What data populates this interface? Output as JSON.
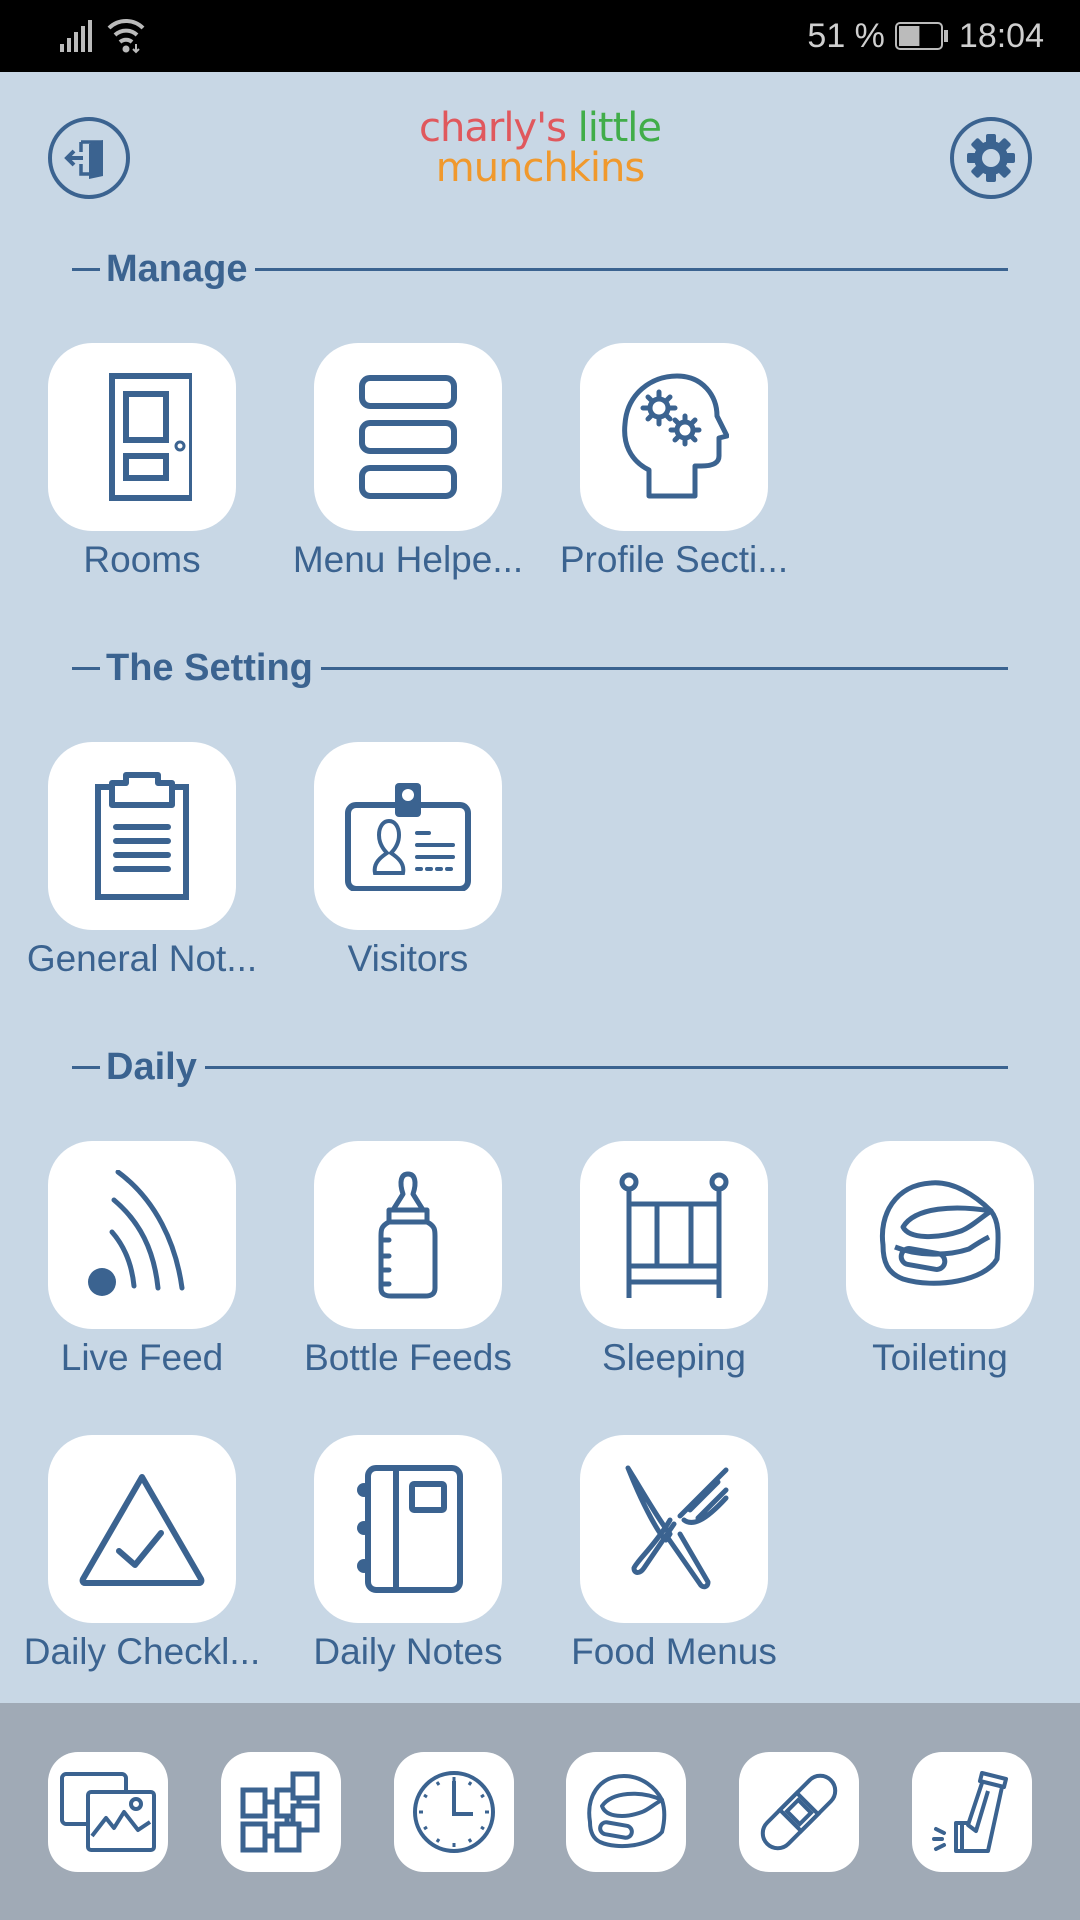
{
  "status_bar": {
    "battery_percent": "51 %",
    "battery_level": 0.51,
    "time": "18:04",
    "icons": [
      "signal-icon",
      "wifi-icon",
      "battery-icon"
    ]
  },
  "header": {
    "logout_icon": "exit-door-icon",
    "settings_icon": "gear-icon",
    "logo": {
      "word1": "charly's",
      "word2": "little",
      "word3": "munchkins"
    },
    "colors": {
      "red": "#e0585d",
      "green": "#41ad49",
      "orange": "#f0992d"
    }
  },
  "theme": {
    "accent": "#3b6390",
    "background": "#c8d7e5",
    "bottom_bar": "#a0aab6",
    "tile": "#ffffff"
  },
  "sections": [
    {
      "title": "Manage",
      "items": [
        {
          "label": "Rooms",
          "icon": "door-icon"
        },
        {
          "label": "Menu Helpe...",
          "icon": "stacked-bars-icon"
        },
        {
          "label": "Profile Secti...",
          "icon": "head-gears-icon"
        }
      ]
    },
    {
      "title": "The Setting",
      "items": [
        {
          "label": "General Not...",
          "icon": "clipboard-icon"
        },
        {
          "label": "Visitors",
          "icon": "id-badge-icon"
        }
      ]
    },
    {
      "title": "Daily",
      "items": [
        {
          "label": "Live Feed",
          "icon": "live-feed-icon"
        },
        {
          "label": "Bottle Feeds",
          "icon": "baby-bottle-icon"
        },
        {
          "label": "Sleeping",
          "icon": "crib-icon"
        },
        {
          "label": "Toileting",
          "icon": "potty-icon"
        },
        {
          "label": "Daily Checkl...",
          "icon": "triangle-check-icon"
        },
        {
          "label": "Daily Notes",
          "icon": "notebook-icon"
        },
        {
          "label": "Food Menus",
          "icon": "knife-fork-icon"
        }
      ]
    }
  ],
  "bottom_bar": [
    {
      "icon": "gallery-icon"
    },
    {
      "icon": "network-blocks-icon"
    },
    {
      "icon": "clock-icon"
    },
    {
      "icon": "potty-icon"
    },
    {
      "icon": "bandage-icon"
    },
    {
      "icon": "inhaler-icon"
    }
  ]
}
